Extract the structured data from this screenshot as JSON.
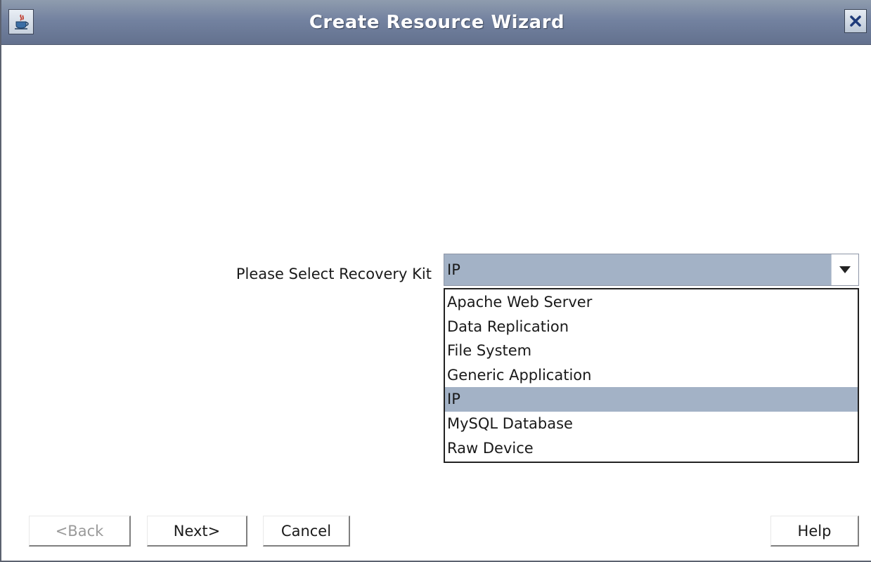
{
  "window": {
    "title": "Create Resource Wizard",
    "icon": "java-cup-icon",
    "close_icon": "close-icon"
  },
  "form": {
    "recovery_kit_label": "Please Select Recovery Kit",
    "selected_value": "IP"
  },
  "dropdown": {
    "options": [
      {
        "label": "Apache Web Server",
        "selected": false
      },
      {
        "label": "Data Replication",
        "selected": false
      },
      {
        "label": "File System",
        "selected": false
      },
      {
        "label": "Generic Application",
        "selected": false
      },
      {
        "label": "IP",
        "selected": true
      },
      {
        "label": "MySQL Database",
        "selected": false
      },
      {
        "label": "Raw Device",
        "selected": false
      }
    ]
  },
  "buttons": {
    "back": {
      "label": "<Back",
      "enabled": false
    },
    "next": {
      "label": "Next>",
      "enabled": true
    },
    "cancel": {
      "label": "Cancel",
      "enabled": true
    },
    "help": {
      "label": "Help",
      "enabled": true
    }
  },
  "colors": {
    "selection": "#a3b2c6",
    "titlebar": "#7382a0"
  }
}
